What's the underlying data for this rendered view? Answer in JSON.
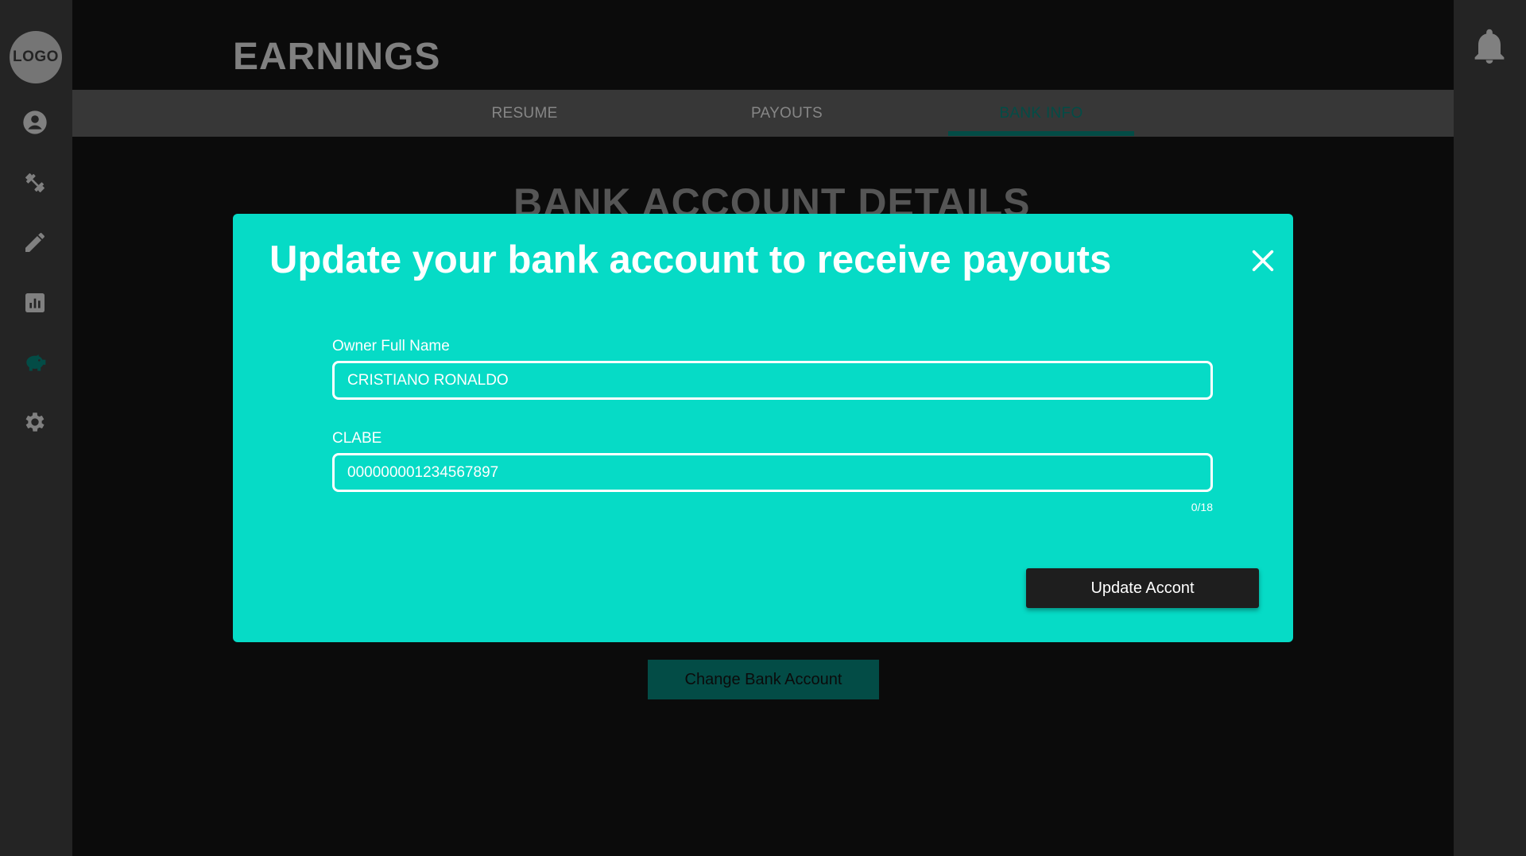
{
  "sidebar": {
    "logo_text": "LOGO",
    "items": [
      {
        "icon": "account-icon"
      },
      {
        "icon": "dumbbell-icon"
      },
      {
        "icon": "pencil-icon"
      },
      {
        "icon": "chart-icon"
      },
      {
        "icon": "piggy-bank-icon",
        "active": true
      },
      {
        "icon": "gear-icon"
      }
    ]
  },
  "header": {
    "title": "EARNINGS",
    "notification_icon": "bell-icon"
  },
  "tabs": [
    {
      "label": "RESUME"
    },
    {
      "label": "PAYOUTS"
    },
    {
      "label": "BANK INFO",
      "active": true
    }
  ],
  "main": {
    "section_title": "BANK ACCOUNT DETAILS",
    "change_button_label": "Change Bank Account"
  },
  "modal": {
    "title": "Update your bank account to receive payouts",
    "owner_label": "Owner Full Name",
    "owner_value": "CRISTIANO RONALDO",
    "clabe_label": "CLABE",
    "clabe_value": "000000001234567897",
    "clabe_counter": "0/18",
    "submit_label": "Update Accont"
  },
  "colors": {
    "accent": "#06dbc6",
    "accent_dark": "#067b72",
    "sidebar": "#3a3a3a",
    "background": "#121212"
  }
}
